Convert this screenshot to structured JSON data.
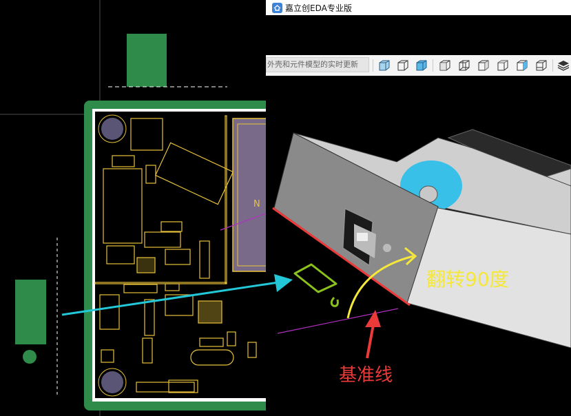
{
  "app": {
    "title": "嘉立创EDA专业版"
  },
  "toolbar": {
    "hint": "外壳和元件模型的实时更新",
    "buttons": [
      "cube-view-icon",
      "cube-outline-icon",
      "cube-shaded-icon",
      "cube-front-icon",
      "cube-back-icon",
      "cube-left-icon",
      "cube-right-icon",
      "cube-top-icon",
      "cube-bottom-icon",
      "layers-icon"
    ]
  },
  "pcb": {
    "silk_label": "N"
  },
  "annotations": {
    "callout": "翻转90度",
    "baseline": "基准线"
  },
  "colors": {
    "board_green": "#2e8b4a",
    "silkscreen": "#e8c23a",
    "pad_outline": "#f2b11e",
    "arrow_cyan": "#22c7d8",
    "annot_yellow": "#f5e83b",
    "annot_red": "#ea3a3a",
    "annot_lime": "#8bc11c",
    "guide_magenta": "#b030c0"
  }
}
